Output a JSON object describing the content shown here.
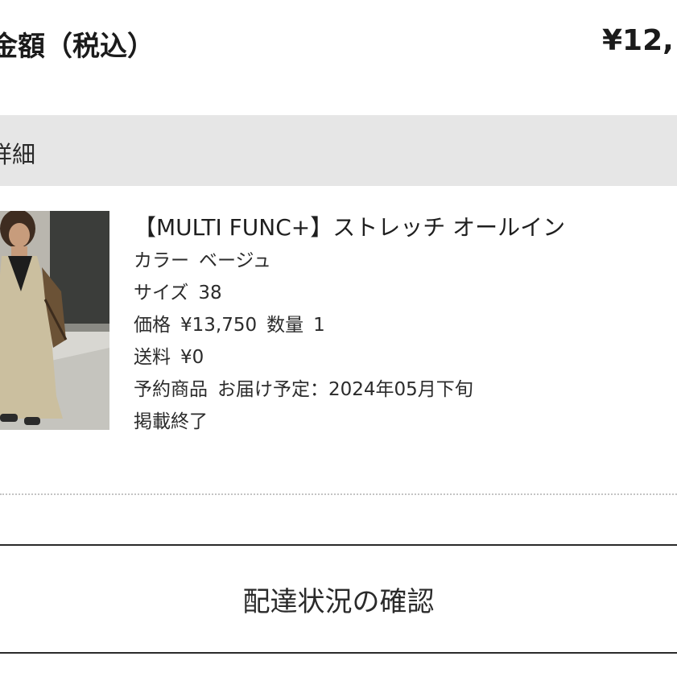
{
  "order_total": {
    "label": "金額（税込）",
    "value": "¥12,"
  },
  "details_header": {
    "label": "詳細"
  },
  "product": {
    "image_icon": "product-photo-beige-jumpsuit",
    "title": "【MULTI FUNC+】ストレッチ オールイン",
    "color_label": "カラー",
    "color_value": "ベージュ",
    "size_label": "サイズ",
    "size_value": "38",
    "price_label": "価格",
    "price_value": "¥13,750",
    "quantity_label": "数量",
    "quantity_value": "1",
    "shipping_label": "送料",
    "shipping_value": "¥0",
    "reservation_label": "予約商品",
    "delivery_schedule": "お届け予定：2024年05月下旬",
    "status": "掲載終了"
  },
  "actions": {
    "delivery_status_button": "配達状況の確認"
  }
}
